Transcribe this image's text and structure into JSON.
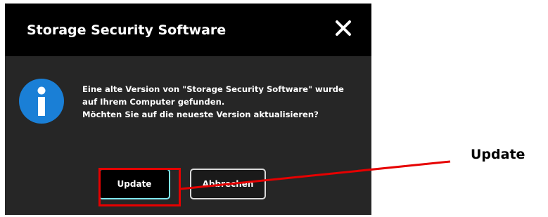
{
  "dialog": {
    "title": "Storage Security Software",
    "close_icon": "close-icon",
    "info_icon": "info-icon",
    "message_lines": [
      "Eine alte Version von \"Storage Security Software\" wurde",
      "auf Ihrem Computer gefunden.",
      "Möchten Sie auf die neueste Version aktualisieren?"
    ],
    "buttons": {
      "update_label": "Update",
      "cancel_label": "Abbrechen"
    }
  },
  "annotation": {
    "label": "Update",
    "color": "#e60000"
  },
  "colors": {
    "titlebar": "#000000",
    "dialog_body": "#262626",
    "info_icon": "#1a7fd6",
    "update_border": "#7fe6ee"
  }
}
